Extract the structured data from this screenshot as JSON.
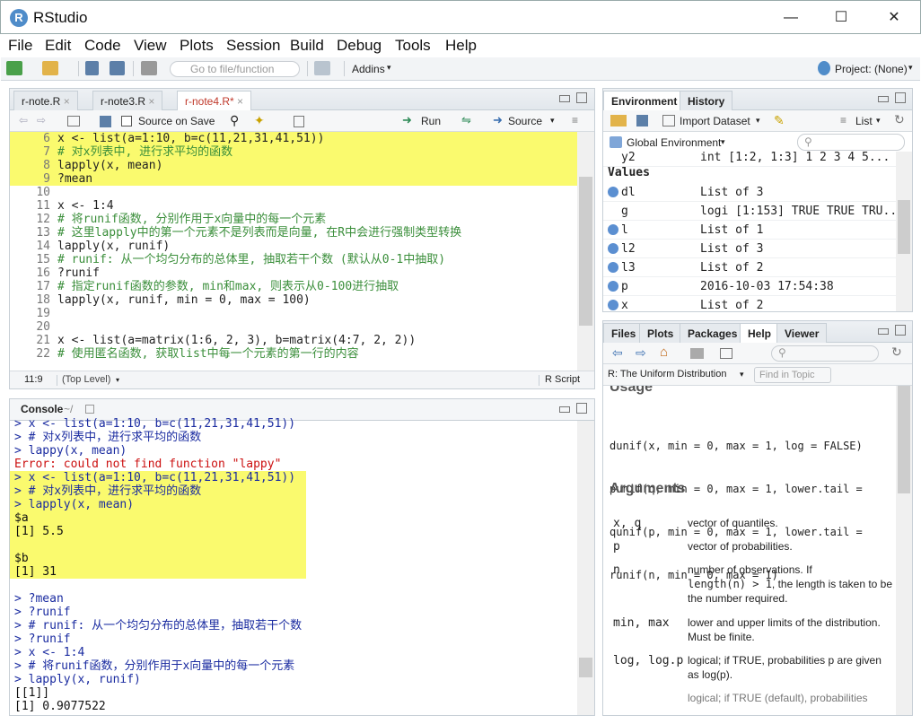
{
  "window": {
    "title": "RStudio"
  },
  "menu": [
    "File",
    "Edit",
    "Code",
    "View",
    "Plots",
    "Session",
    "Build",
    "Debug",
    "Tools",
    "Help"
  ],
  "toolbar": {
    "goto_placeholder": "Go to file/function",
    "addins": "Addins",
    "project": "Project: (None)"
  },
  "editor": {
    "tabs": [
      "r-note.R",
      "r-note3.R",
      "r-note4.R*"
    ],
    "source_on_save": "Source on Save",
    "run": "Run",
    "source": "Source",
    "lines": [
      {
        "n": "6",
        "text": "x <- list(a=1:10, b=c(11,21,31,41,51))",
        "hl": true,
        "type": "code"
      },
      {
        "n": "7",
        "text": "# 对x列表中, 进行求平均的函数",
        "hl": true,
        "type": "cm"
      },
      {
        "n": "8",
        "text": "lapply(x, mean)",
        "hl": true,
        "type": "code"
      },
      {
        "n": "9",
        "text": "?mean",
        "hl": true,
        "type": "code"
      },
      {
        "n": "10",
        "text": "",
        "hl": false,
        "type": "code"
      },
      {
        "n": "11",
        "text": "x <- 1:4",
        "hl": false,
        "type": "code"
      },
      {
        "n": "12",
        "text": "# 将runif函数, 分别作用于x向量中的每一个元素",
        "hl": false,
        "type": "cm"
      },
      {
        "n": "13",
        "text": "# 这里lapply中的第一个元素不是列表而是向量, 在R中会进行强制类型转换",
        "hl": false,
        "type": "cm"
      },
      {
        "n": "14",
        "text": "lapply(x, runif)",
        "hl": false,
        "type": "code"
      },
      {
        "n": "15",
        "text": "# runif: 从一个均匀分布的总体里, 抽取若干个数 (默认从0-1中抽取)",
        "hl": false,
        "type": "cm"
      },
      {
        "n": "16",
        "text": "?runif",
        "hl": false,
        "type": "code"
      },
      {
        "n": "17",
        "text": "# 指定runif函数的参数, min和max, 则表示从0-100进行抽取",
        "hl": false,
        "type": "cm"
      },
      {
        "n": "18",
        "text": "lapply(x, runif, min = 0, max = 100)",
        "hl": false,
        "type": "code"
      },
      {
        "n": "19",
        "text": "",
        "hl": false,
        "type": "code"
      },
      {
        "n": "20",
        "text": "",
        "hl": false,
        "type": "code"
      },
      {
        "n": "21",
        "text": "x <- list(a=matrix(1:6, 2, 3), b=matrix(4:7, 2, 2))",
        "hl": false,
        "type": "code"
      },
      {
        "n": "22",
        "text": "# 使用匿名函数, 获取list中每一个元素的第一行的内容",
        "hl": false,
        "type": "cm"
      }
    ],
    "status": {
      "pos": "11:9",
      "scope": "(Top Level)",
      "type": "R Script"
    }
  },
  "console": {
    "title": "Console",
    "path": "~/",
    "lines": [
      {
        "text": "> x <- list(a=1:10, b=c(11,21,31,41,51))",
        "type": "in",
        "hl": false
      },
      {
        "text": "> # 对x列表中，进行求平均的函数",
        "type": "in",
        "hl": false
      },
      {
        "text": "> lappy(x, mean)",
        "type": "in",
        "hl": false
      },
      {
        "text": "Error: could not find function \"lappy\"",
        "type": "err",
        "hl": false
      },
      {
        "text": "> x <- list(a=1:10, b=c(11,21,31,41,51))",
        "type": "in",
        "hl": true
      },
      {
        "text": "> # 对x列表中，进行求平均的函数",
        "type": "in",
        "hl": true
      },
      {
        "text": "> lapply(x, mean)",
        "type": "in",
        "hl": true
      },
      {
        "text": "$a",
        "type": "out",
        "hl": true
      },
      {
        "text": "[1] 5.5",
        "type": "out",
        "hl": true
      },
      {
        "text": "",
        "type": "out",
        "hl": true
      },
      {
        "text": "$b",
        "type": "out",
        "hl": true
      },
      {
        "text": "[1] 31",
        "type": "out",
        "hl": true
      },
      {
        "text": "",
        "type": "out",
        "hl": false
      },
      {
        "text": "> ?mean",
        "type": "in",
        "hl": false
      },
      {
        "text": "> ?runif",
        "type": "in",
        "hl": false
      },
      {
        "text": "> # runif: 从一个均匀分布的总体里，抽取若干个数",
        "type": "in",
        "hl": false
      },
      {
        "text": "> ?runif",
        "type": "in",
        "hl": false
      },
      {
        "text": "> x <- 1:4",
        "type": "in",
        "hl": false
      },
      {
        "text": "> # 将runif函数，分别作用于x向量中的每一个元素",
        "type": "in",
        "hl": false
      },
      {
        "text": "> lapply(x, runif)",
        "type": "in",
        "hl": false
      },
      {
        "text": "[[1]]",
        "type": "out",
        "hl": false
      },
      {
        "text": "[1] 0.9077522",
        "type": "out",
        "hl": false
      }
    ]
  },
  "environment": {
    "tabs": [
      "Environment",
      "History"
    ],
    "import": "Import Dataset",
    "list": "List",
    "scope": "Global Environment",
    "top_row": {
      "name": "y2",
      "value": "int [1:2, 1:3] 1 2 3 4 5..."
    },
    "section": "Values",
    "rows": [
      {
        "name": "dl",
        "value": "List of 3",
        "bullet": true
      },
      {
        "name": "g",
        "value": "logi [1:153] TRUE TRUE TRU...",
        "bullet": false
      },
      {
        "name": "l",
        "value": "List of 1",
        "bullet": true
      },
      {
        "name": "l2",
        "value": "List of 3",
        "bullet": true
      },
      {
        "name": "l3",
        "value": "List of 2",
        "bullet": true
      },
      {
        "name": "p",
        "value": "2016-10-03 17:54:38",
        "bullet": true
      },
      {
        "name": "x",
        "value": "List of 2",
        "bullet": true
      }
    ]
  },
  "help": {
    "tabs": [
      "Files",
      "Plots",
      "Packages",
      "Help",
      "Viewer"
    ],
    "topic": "R: The Uniform Distribution",
    "find_placeholder": "Find in Topic",
    "usage_heading": "Usage",
    "usage": [
      "dunif(x, min = 0, max = 1, log = FALSE)",
      "punif(q, min = 0, max = 1, lower.tail =",
      "qunif(p, min = 0, max = 1, lower.tail =",
      "runif(n, min = 0, max = 1)"
    ],
    "args_heading": "Arguments",
    "args": [
      {
        "name": "x, q",
        "desc": "vector of quantiles."
      },
      {
        "name": "p",
        "desc": "vector of probabilities."
      },
      {
        "name": "n",
        "desc_a": "number of observations. If",
        "desc_code": "length(n) > 1",
        "desc_b": ", the length is taken to be the number required."
      },
      {
        "name": "min, max",
        "desc": "lower and upper limits of the distribution. Must be finite."
      },
      {
        "name": "log, log.p",
        "desc": "logical; if TRUE, probabilities p are given as log(p)."
      }
    ],
    "cut_text": "logical; if TRUE (default), probabilities"
  }
}
